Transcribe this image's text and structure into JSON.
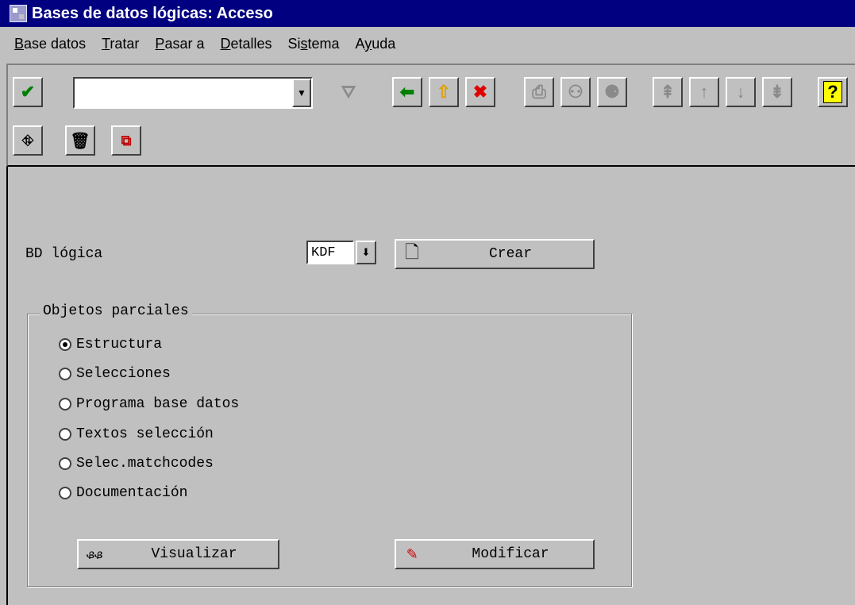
{
  "window": {
    "title": "Bases de datos lógicas: Acceso"
  },
  "menu": [
    {
      "label": "Base datos",
      "u": "B",
      "rest": "ase datos"
    },
    {
      "label": "Tratar",
      "u": "T",
      "rest": "ratar"
    },
    {
      "label": "Pasar a",
      "u": "P",
      "rest": "asar a"
    },
    {
      "label": "Detalles",
      "u": "D",
      "rest": "etalles"
    },
    {
      "label": "Sistema",
      "pre": "Si",
      "u": "s",
      "rest": "tema"
    },
    {
      "label": "Ayuda",
      "pre": "A",
      "u": "y",
      "rest": "uda"
    }
  ],
  "toolbar": {
    "command_value": ""
  },
  "form": {
    "bd_label": "BD lógica",
    "bd_value": "KDF",
    "create_label": "Crear",
    "group_title": "Objetos parciales",
    "options": [
      "Estructura",
      "Selecciones",
      "Programa base datos",
      "Textos selección",
      "Selec.matchcodes",
      "Documentación"
    ],
    "selected_index": 0,
    "display_label": "Visualizar",
    "modify_label": "Modificar"
  },
  "colors": {
    "titlebar": "#000080",
    "face": "#c0c0c0",
    "help": "#ffff00"
  }
}
